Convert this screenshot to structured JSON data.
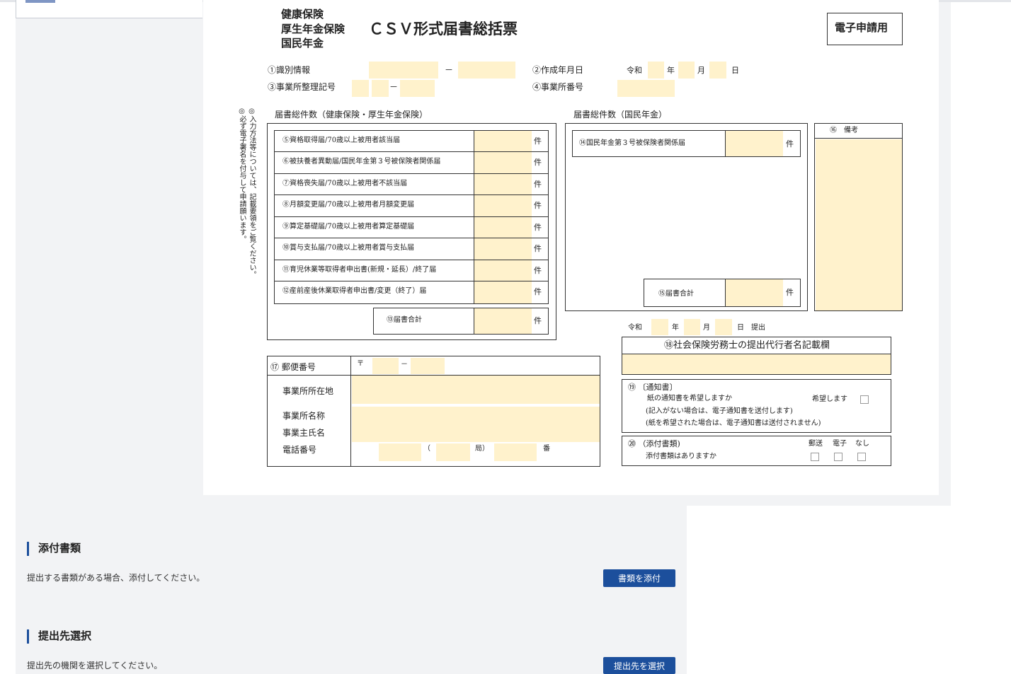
{
  "colors": {
    "accent": "#1c4f9c",
    "field": "#fff2cc",
    "panel": "#f2f3f5"
  },
  "form": {
    "title_left": [
      "健康保険",
      "厚生年金保険",
      "国民年金"
    ],
    "title_main": "ＣＳＶ形式届書総括票",
    "badge": "電子申請用",
    "id_label": "①識別情報",
    "dash": "－",
    "created_label": "②作成年月日",
    "era": "令和",
    "year": "年",
    "month": "月",
    "day": "日",
    "office_code_label": "③事業所整理記号",
    "office_no_label": "④事業所番号",
    "vertical_note_1": "◎入力方法等については、記載要領をご覧ください。",
    "vertical_note_2": "◎必ず電子署名を付与して申請願います。",
    "health_header": "届書総件数（健康保険・厚生年金保険）",
    "pension_header": "届書総件数（国民年金）",
    "unit": "件",
    "health_rows": [
      "⑤資格取得届/70歳以上被用者該当届",
      "⑥被扶養者異動届/国民年金第３号被保険者関係届",
      "⑦資格喪失届/70歳以上被用者不該当届",
      "⑧月額変更届/70歳以上被用者月額変更届",
      "⑨算定基礎届/70歳以上被用者算定基礎届",
      "⑩賞与支払届/70歳以上被用者賞与支払届",
      "⑪育児休業等取得者申出書(新規・延長）/終了届",
      "⑫産前産後休業取得者申出書/変更（終了）届"
    ],
    "health_total": "⑬届書合計",
    "pension_row": "⑭国民年金第３号被保険者関係届",
    "pension_total": "⑮届書合計",
    "remarks": "⑯　備考",
    "postal_label": "⑰ 郵便番号",
    "postal_mark": "〒",
    "address_label": "事業所所在地",
    "office_name_label": "事業所名称",
    "owner_label": "事業主氏名",
    "phone_label": "電話番号",
    "phone_paren": "（",
    "phone_kyoku": "局）",
    "phone_ban": "番",
    "submit_date_suffix": "日　提出",
    "agent_label": "⑱社会保険労務士の提出代行者名記載欄",
    "notice_title": "⑲ 〔通知書〕",
    "notice_q": "紙の通知書を希望しますか",
    "notice_yes": "希望します",
    "notice_note1": "(記入がない場合は、電子通知書を送付します)",
    "notice_note2": "(紙を希望された場合は、電子通知書は送付されません)",
    "attach_title": "⑳ （添付書類)",
    "attach_q": "添付書類はありますか",
    "attach_opts": [
      "郵送",
      "電子",
      "なし"
    ]
  },
  "sections": {
    "attach_heading": "添付書類",
    "attach_desc": "提出する書類がある場合、添付してください。",
    "attach_button": "書類を添付",
    "dest_heading": "提出先選択",
    "dest_desc": "提出先の機関を選択してください。",
    "dest_button": "提出先を選択"
  }
}
